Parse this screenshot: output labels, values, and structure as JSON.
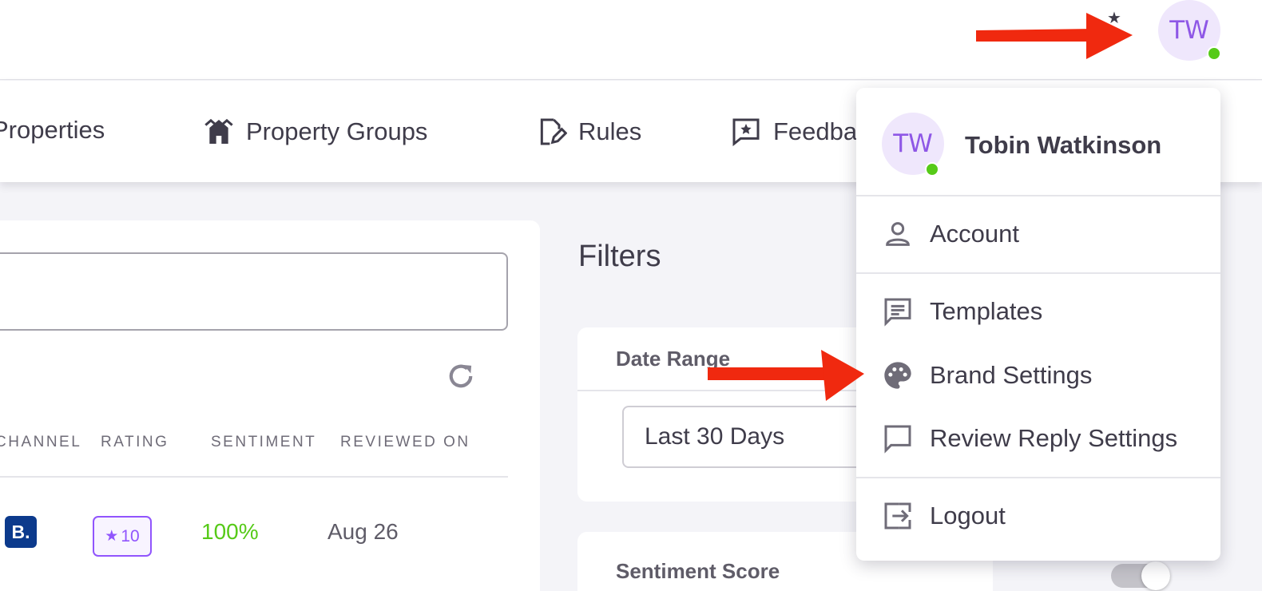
{
  "topbar": {
    "avatar_initials": "TW"
  },
  "nav": {
    "items": [
      {
        "label": "Properties",
        "icon": "home-icon"
      },
      {
        "label": "Property Groups",
        "icon": "property-groups-icon"
      },
      {
        "label": "Rules",
        "icon": "rules-edit-icon"
      },
      {
        "label": "Feedba",
        "icon": "feedback-star-icon"
      }
    ]
  },
  "reviews": {
    "columns": [
      "CHANNEL",
      "RATING",
      "SENTIMENT",
      "REVIEWED ON"
    ],
    "rows": [
      {
        "channel_logo": "B.",
        "rating": "10",
        "sentiment": "100%",
        "reviewed_on": "Aug 26"
      }
    ],
    "colors": {
      "sentiment_positive": "#56ca18",
      "accent": "#9155fd"
    }
  },
  "filters": {
    "title": "Filters",
    "date_range": {
      "label": "Date Range",
      "value": "Last 30 Days"
    },
    "sentiment_score": {
      "label": "Sentiment Score"
    }
  },
  "user_menu": {
    "avatar_initials": "TW",
    "user_name": "Tobin Watkinson",
    "items": [
      {
        "label": "Account",
        "icon": "account-icon"
      },
      {
        "label": "Templates",
        "icon": "templates-icon"
      },
      {
        "label": "Brand Settings",
        "icon": "palette-icon"
      },
      {
        "label": "Review Reply Settings",
        "icon": "review-reply-icon"
      },
      {
        "label": "Logout",
        "icon": "logout-icon"
      }
    ]
  },
  "annotations": {
    "arrow_color": "#f0290f"
  }
}
